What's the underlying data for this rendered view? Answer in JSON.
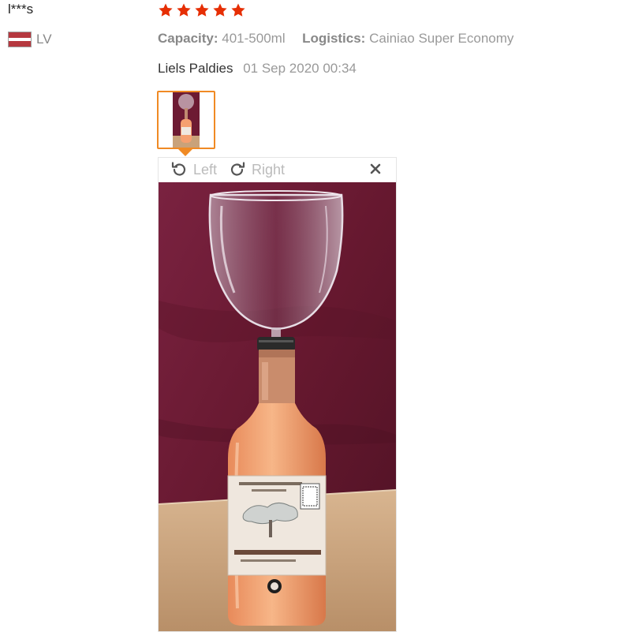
{
  "review": {
    "user_name": "l***s",
    "country_code": "LV",
    "rating": 5,
    "attributes": [
      {
        "key": "Capacity:",
        "value": "401-500ml"
      },
      {
        "key": "Logistics:",
        "value": "Cainiao Super Economy"
      }
    ],
    "reviewer_display": "Liels Paldies",
    "date": "01 Sep 2020 00:34"
  },
  "viewer": {
    "rotate_left_label": "Left",
    "rotate_right_label": "Right",
    "close_icon": "close-icon"
  },
  "colors": {
    "star": "#e62e04",
    "accent": "#f08a24",
    "flag_red": "#b5383f",
    "backdrop": "#6d1a33",
    "table": "#c9a27a",
    "wine": "#f5a070"
  }
}
